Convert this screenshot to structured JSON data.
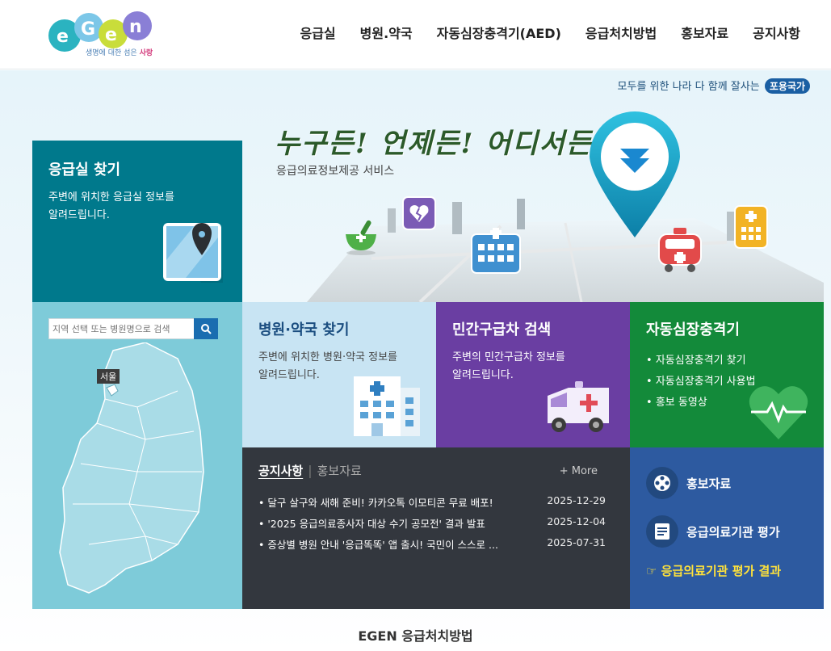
{
  "logo": {
    "tagline_prefix": "생명에 대한 섬은",
    "tagline_emph": "사랑"
  },
  "nav": {
    "items": [
      "응급실",
      "병원.약국",
      "자동심장충격기(AED)",
      "응급처치방법",
      "홍보자료",
      "공지사항"
    ]
  },
  "slogan": {
    "text": "모두를 위한 나라 다 함께 잘사는",
    "pill": "포용국가"
  },
  "hero": {
    "title": "누구든! 언제든! 어디서든!",
    "subtitle": "응급의료정보제공 서비스"
  },
  "er": {
    "title": "응급실 찾기",
    "desc_line1": "주변에 위치한 응급실 정보를",
    "desc_line2": "알려드립니다."
  },
  "search": {
    "placeholder": "지역 선택 또는 병원명으로 검색",
    "region_label": "서울"
  },
  "hospital": {
    "title": "병원·약국 찾기",
    "desc_line1": "주변에 위치한 병원·약국 정보를",
    "desc_line2": "알려드립니다."
  },
  "ambulance": {
    "title": "민간구급차 검색",
    "desc_line1": "주변의 민간구급차 정보를",
    "desc_line2": "알려드립니다."
  },
  "aed": {
    "title": "자동심장충격기",
    "items": [
      "자동심장충격기 찾기",
      "자동심장충격기 사용법",
      "홍보 동영상"
    ]
  },
  "notice": {
    "tab_active": "공지사항",
    "tab_inactive": "홍보자료",
    "more": "+ More",
    "items": [
      {
        "title": "달구 살구와 새해 준비! 카카오톡 이모티콘 무료 배포!",
        "date": "2025-12-29"
      },
      {
        "title": "'2025 응급의료종사자 대상 수기 공모전' 결과 발표",
        "date": "2025-12-04"
      },
      {
        "title": "증상별 병원 안내 '응급똑똑' 앱 출시! 국민이 스스로 ...",
        "date": "2025-07-31"
      }
    ]
  },
  "links": {
    "promo": "홍보자료",
    "eval": "응급의료기관 평가",
    "result": "☞ 응급의료기관 평가 결과"
  },
  "footer": {
    "section_title": "EGEN 응급처치방법"
  },
  "colors": {
    "er": "#00798c",
    "map": "#7ecbd9",
    "hospital": "#c8e4f3",
    "ambulance": "#6a3ea2",
    "aed": "#138a3a",
    "notice": "#33373e",
    "links": "#2d5aa0",
    "highlight": "#ffe23b"
  }
}
